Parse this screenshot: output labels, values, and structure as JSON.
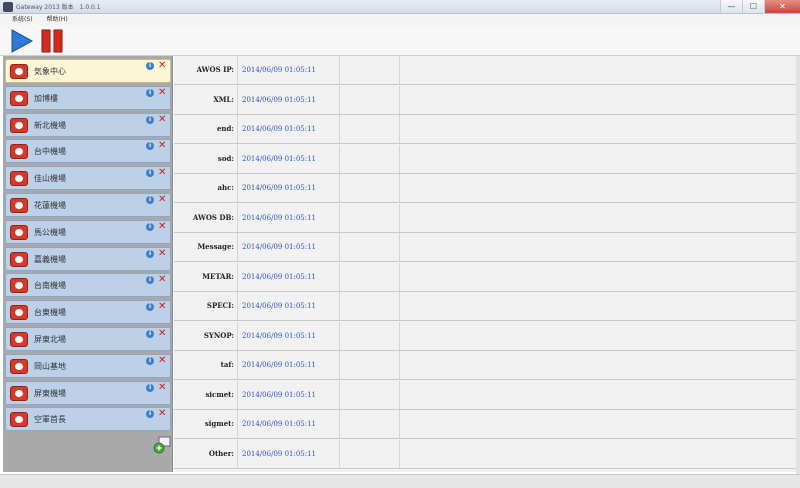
{
  "window": {
    "title": "Gateway 2013 版本　1.0.0.1",
    "controls": {
      "minimize": "—",
      "maximize": "☐",
      "close": "✕"
    }
  },
  "menu": {
    "items": [
      "系统(S)",
      "帮助(H)"
    ]
  },
  "toolbar": {
    "start_icon": "play-icon",
    "stop_icon": "pause-icon",
    "colors": {
      "play": "#2f7ad6",
      "pause": "#d32a22"
    }
  },
  "sidebar": {
    "items": [
      {
        "label": "気象中心",
        "active": true
      },
      {
        "label": "加博樓",
        "active": false
      },
      {
        "label": "新北機場",
        "active": false
      },
      {
        "label": "台中機場",
        "active": false
      },
      {
        "label": "佳山機場",
        "active": false
      },
      {
        "label": "花蓮機場",
        "active": false
      },
      {
        "label": "馬公機場",
        "active": false
      },
      {
        "label": "嘉義機場",
        "active": false
      },
      {
        "label": "台南機場",
        "active": false
      },
      {
        "label": "台東機場",
        "active": false
      },
      {
        "label": "屏東北場",
        "active": false
      },
      {
        "label": "岡山基地",
        "active": false
      },
      {
        "label": "屏東機場",
        "active": false
      },
      {
        "label": "空軍首長",
        "active": false
      }
    ],
    "add_icon": "add-monitor-icon"
  },
  "grid": {
    "rows": [
      {
        "name": "AWOS IP:",
        "time": "2014/06/09 01:05:11"
      },
      {
        "name": "XML:",
        "time": "2014/06/09 01:05:11"
      },
      {
        "name": "end:",
        "time": "2014/06/09 01:05:11"
      },
      {
        "name": "sod:",
        "time": "2014/06/09 01:05:11"
      },
      {
        "name": "ahc:",
        "time": "2014/06/09 01:05:11"
      },
      {
        "name": "AWOS DB:",
        "time": "2014/06/09 01:05:11"
      },
      {
        "name": "Message:",
        "time": "2014/06/09 01:05:11"
      },
      {
        "name": "METAR:",
        "time": "2014/06/09 01:05:11"
      },
      {
        "name": "SPECI:",
        "time": "2014/06/09 01:05:11"
      },
      {
        "name": "SYNOP:",
        "time": "2014/06/09 01:05:11"
      },
      {
        "name": "taf:",
        "time": "2014/06/09 01:05:11"
      },
      {
        "name": "sicmet:",
        "time": "2014/06/09 01:05:11"
      },
      {
        "name": "sigmet:",
        "time": "2014/06/09 01:05:11"
      },
      {
        "name": "Other:",
        "time": "2014/06/09 01:05:11"
      }
    ]
  }
}
